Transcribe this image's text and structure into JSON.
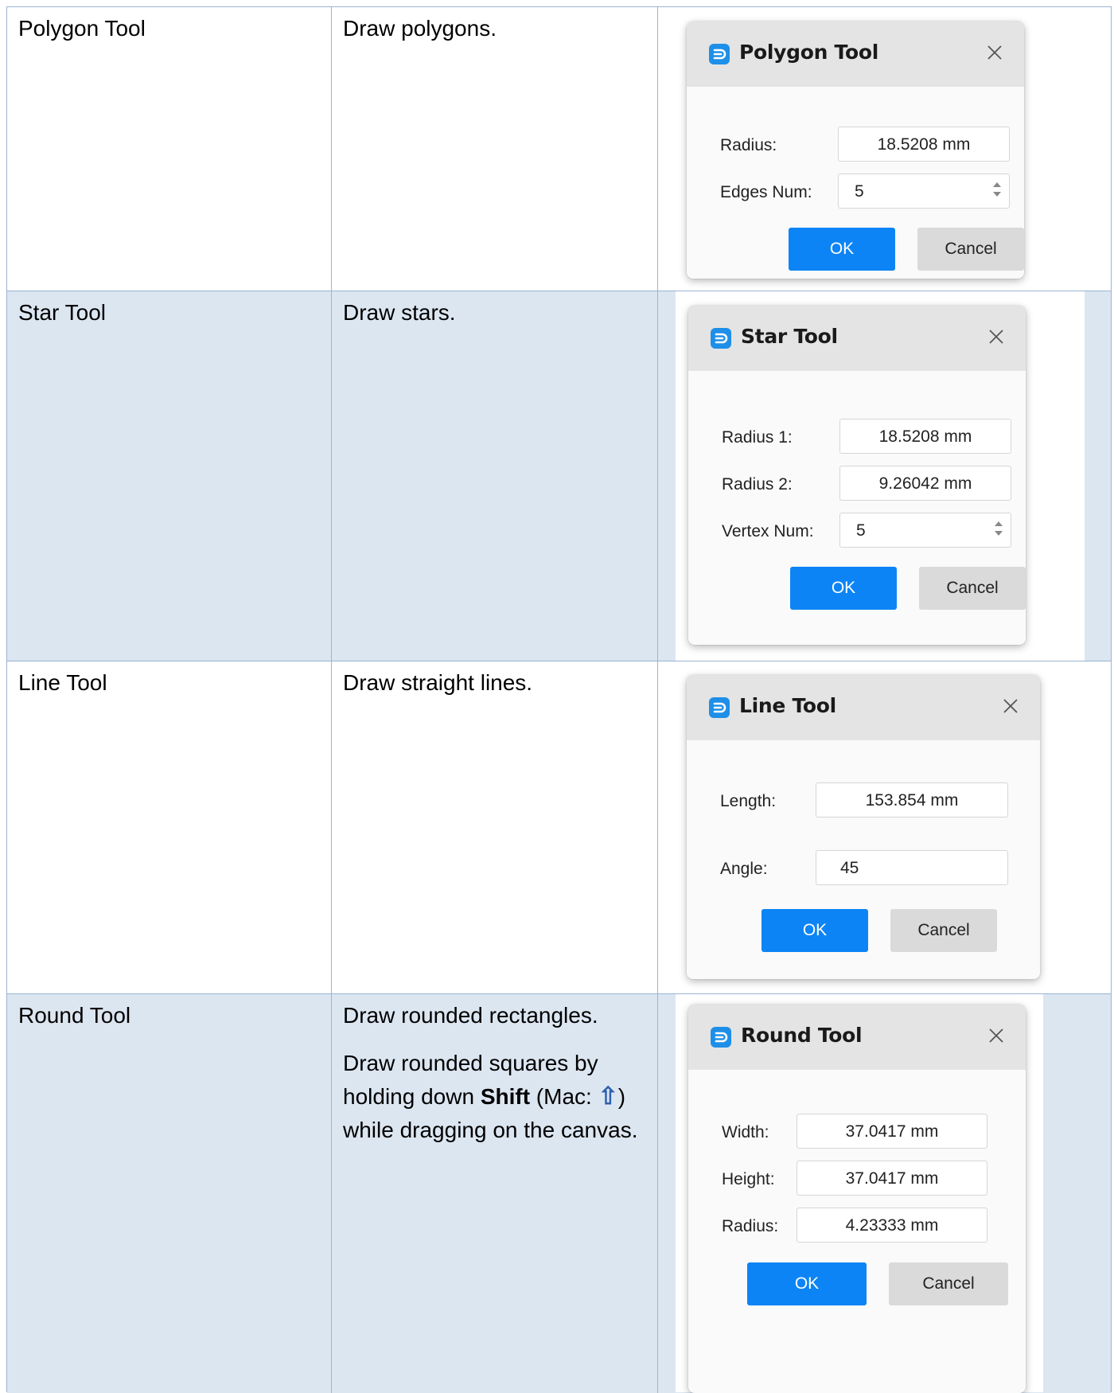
{
  "rows": [
    {
      "tool": "Polygon Tool",
      "description": [
        "Draw polygons."
      ],
      "dialog": {
        "title": "Polygon Tool",
        "fields": [
          {
            "label": "Radius:",
            "value": "18.5208 mm"
          },
          {
            "label": "Edges Num:",
            "value": "5"
          }
        ],
        "ok": "OK",
        "cancel": "Cancel"
      }
    },
    {
      "tool": "Star Tool",
      "description": [
        "Draw stars."
      ],
      "dialog": {
        "title": "Star Tool",
        "fields": [
          {
            "label": "Radius 1:",
            "value": "18.5208 mm"
          },
          {
            "label": "Radius 2:",
            "value": "9.26042 mm"
          },
          {
            "label": "Vertex Num:",
            "value": "5"
          }
        ],
        "ok": "OK",
        "cancel": "Cancel"
      }
    },
    {
      "tool": "Line Tool",
      "description": [
        "Draw straight lines."
      ],
      "dialog": {
        "title": "Line Tool",
        "fields": [
          {
            "label": "Length:",
            "value": "153.854 mm"
          },
          {
            "label": "Angle:",
            "value": "45"
          }
        ],
        "ok": "OK",
        "cancel": "Cancel"
      }
    },
    {
      "tool": "Round Tool",
      "description": [
        "Draw rounded rectangles."
      ],
      "description_2": {
        "before": "Draw rounded squares by holding down ",
        "key": "Shift",
        "mac_prefix": " (Mac: ",
        "mac_key": "⇧",
        "after": ") while dragging on the canvas."
      },
      "dialog": {
        "title": "Round Tool",
        "fields": [
          {
            "label": "Width:",
            "value": "37.0417 mm"
          },
          {
            "label": "Height:",
            "value": "37.0417 mm"
          },
          {
            "label": "Radius:",
            "value": "4.23333 mm"
          }
        ],
        "ok": "OK",
        "cancel": "Cancel"
      }
    }
  ],
  "icons": {
    "dialog_logo": "app-logo-icon",
    "close": "close-icon",
    "spin": "spin-arrows-icon"
  },
  "colors": {
    "table_border": "#9ab4d4",
    "row_shade": "#dce6f1",
    "ok_button": "#0d84f5",
    "cancel_button": "#dadada",
    "titlebar": "#e4e4e4"
  }
}
